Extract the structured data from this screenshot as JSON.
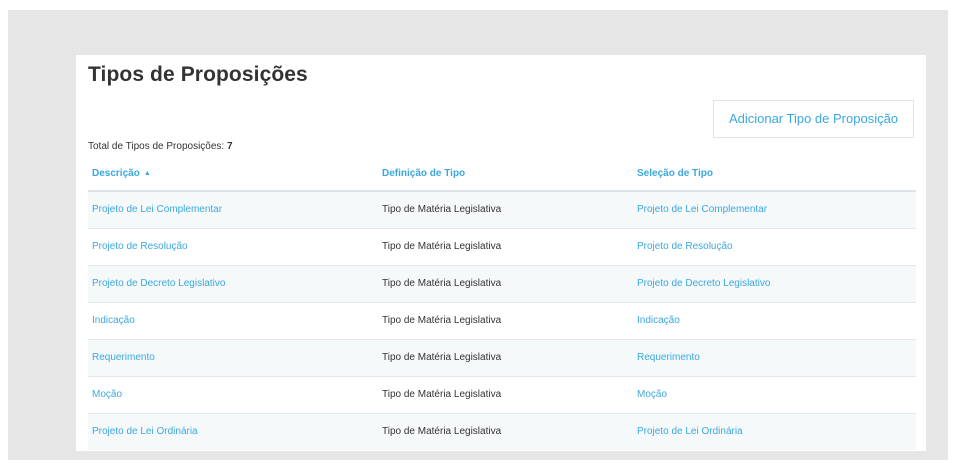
{
  "page": {
    "title": "Tipos de Proposições",
    "add_button_label": "Adicionar Tipo de Proposição",
    "total_label": "Total de Tipos de Proposições:",
    "total_count": "7"
  },
  "table": {
    "headers": {
      "descricao": "Descrição",
      "definicao": "Definição de Tipo",
      "selecao": "Seleção de Tipo"
    },
    "sort_icon": "▲",
    "rows": [
      {
        "descricao": "Projeto de Lei Complementar",
        "definicao": "Tipo de Matéria Legislativa",
        "selecao": "Projeto de Lei Complementar"
      },
      {
        "descricao": "Projeto de Resolução",
        "definicao": "Tipo de Matéria Legislativa",
        "selecao": "Projeto de Resolução"
      },
      {
        "descricao": "Projeto de Decreto Legislativo",
        "definicao": "Tipo de Matéria Legislativa",
        "selecao": "Projeto de Decreto Legislativo"
      },
      {
        "descricao": "Indicação",
        "definicao": "Tipo de Matéria Legislativa",
        "selecao": "Indicação"
      },
      {
        "descricao": "Requerimento",
        "definicao": "Tipo de Matéria Legislativa",
        "selecao": "Requerimento"
      },
      {
        "descricao": "Moção",
        "definicao": "Tipo de Matéria Legislativa",
        "selecao": "Moção"
      },
      {
        "descricao": "Projeto de Lei Ordinária",
        "definicao": "Tipo de Matéria Legislativa",
        "selecao": "Projeto de Lei Ordinária"
      }
    ]
  },
  "colors": {
    "accent": "#3aa8e0",
    "text": "#333333",
    "frame_background": "#e6e6e6",
    "row_stripe": "#f5f9fa"
  }
}
